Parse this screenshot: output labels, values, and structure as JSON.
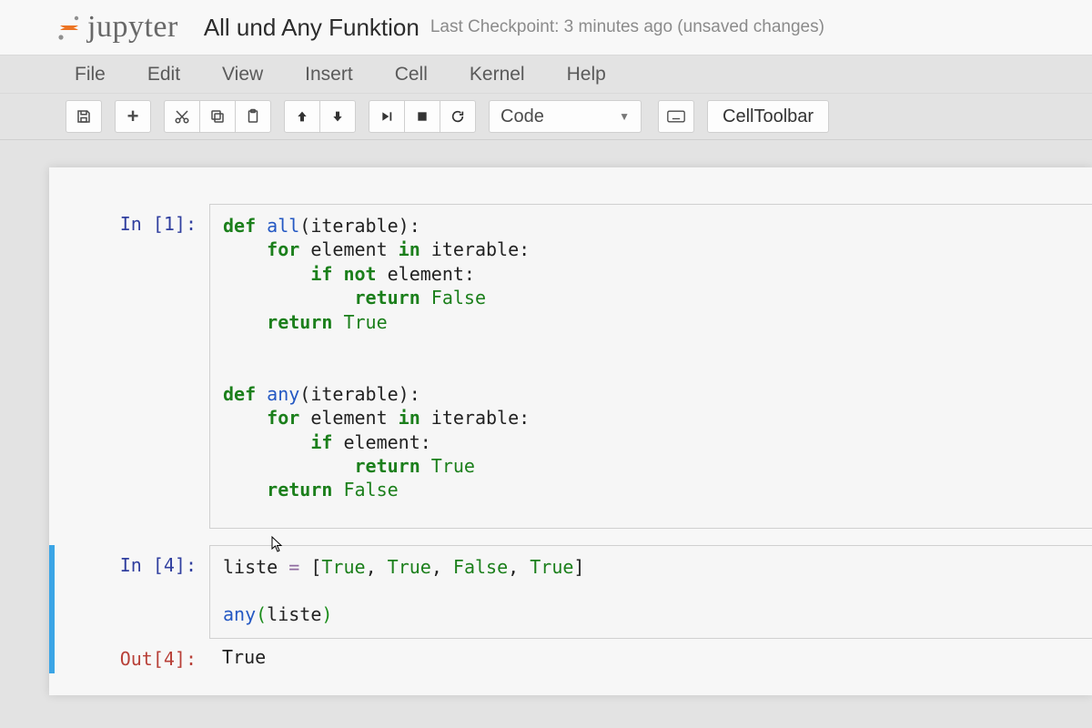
{
  "header": {
    "logo_text": "jupyter",
    "notebook_title": "All und Any Funktion",
    "checkpoint_prefix": "Last Checkpoint: ",
    "checkpoint_time": "3 minutes ago",
    "checkpoint_suffix": " (unsaved changes)"
  },
  "menubar": [
    "File",
    "Edit",
    "View",
    "Insert",
    "Cell",
    "Kernel",
    "Help"
  ],
  "toolbar": {
    "celltype_selected": "Code",
    "celltoolbar_label": "CellToolbar"
  },
  "cells": {
    "c1": {
      "prompt": "In [1]:",
      "code_lines": [
        [
          [
            "kw",
            "def"
          ],
          [
            "pn",
            " "
          ],
          [
            "fn",
            "all"
          ],
          [
            "pn",
            "(iterable):"
          ]
        ],
        [
          [
            "pn",
            "    "
          ],
          [
            "kw",
            "for"
          ],
          [
            "pn",
            " element "
          ],
          [
            "kw",
            "in"
          ],
          [
            "pn",
            " iterable:"
          ]
        ],
        [
          [
            "pn",
            "        "
          ],
          [
            "kw",
            "if"
          ],
          [
            "pn",
            " "
          ],
          [
            "kw",
            "not"
          ],
          [
            "pn",
            " element:"
          ]
        ],
        [
          [
            "pn",
            "            "
          ],
          [
            "kw",
            "return"
          ],
          [
            "pn",
            " "
          ],
          [
            "lt",
            "False"
          ]
        ],
        [
          [
            "pn",
            "    "
          ],
          [
            "kw",
            "return"
          ],
          [
            "pn",
            " "
          ],
          [
            "lt",
            "True"
          ]
        ],
        [],
        [],
        [
          [
            "kw",
            "def"
          ],
          [
            "pn",
            " "
          ],
          [
            "fn",
            "any"
          ],
          [
            "pn",
            "(iterable):"
          ]
        ],
        [
          [
            "pn",
            "    "
          ],
          [
            "kw",
            "for"
          ],
          [
            "pn",
            " element "
          ],
          [
            "kw",
            "in"
          ],
          [
            "pn",
            " iterable:"
          ]
        ],
        [
          [
            "pn",
            "        "
          ],
          [
            "kw",
            "if"
          ],
          [
            "pn",
            " element:"
          ]
        ],
        [
          [
            "pn",
            "            "
          ],
          [
            "kw",
            "return"
          ],
          [
            "pn",
            " "
          ],
          [
            "lt",
            "True"
          ]
        ],
        [
          [
            "pn",
            "    "
          ],
          [
            "kw",
            "return"
          ],
          [
            "pn",
            " "
          ],
          [
            "lt",
            "False"
          ]
        ]
      ]
    },
    "c2": {
      "prompt": "In [4]:",
      "code_lines": [
        [
          [
            "id",
            "liste "
          ],
          [
            "op",
            "="
          ],
          [
            "pn",
            " ["
          ],
          [
            "lt",
            "True"
          ],
          [
            "pn",
            ", "
          ],
          [
            "lt",
            "True"
          ],
          [
            "pn",
            ", "
          ],
          [
            "lt",
            "False"
          ],
          [
            "pn",
            ", "
          ],
          [
            "lt",
            "True"
          ],
          [
            "pn",
            "]"
          ]
        ],
        [],
        [
          [
            "fn",
            "any"
          ],
          [
            "par-hl",
            "("
          ],
          [
            "id",
            "liste"
          ],
          [
            "par-hl",
            ")"
          ]
        ]
      ],
      "out_prompt": "Out[4]:",
      "out_value": "True"
    }
  }
}
